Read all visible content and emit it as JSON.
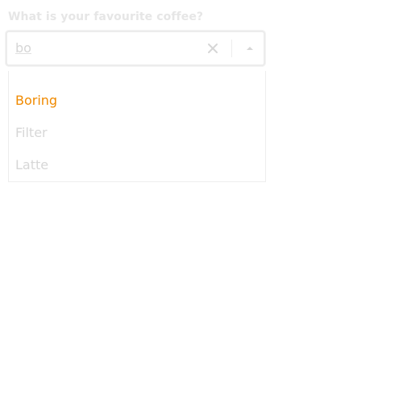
{
  "form": {
    "label": "What is your favourite coffee?"
  },
  "combobox": {
    "value": "bo",
    "icons": {
      "clear": "close-icon",
      "toggle": "caret-up-icon"
    }
  },
  "menu": {
    "options": [
      {
        "label": "Boring",
        "highlighted": true
      },
      {
        "label": "Filter",
        "highlighted": false
      },
      {
        "label": "Latte",
        "highlighted": false
      }
    ]
  },
  "colors": {
    "highlight_text": "#f08a00",
    "muted_text": "#d7d7d7"
  }
}
